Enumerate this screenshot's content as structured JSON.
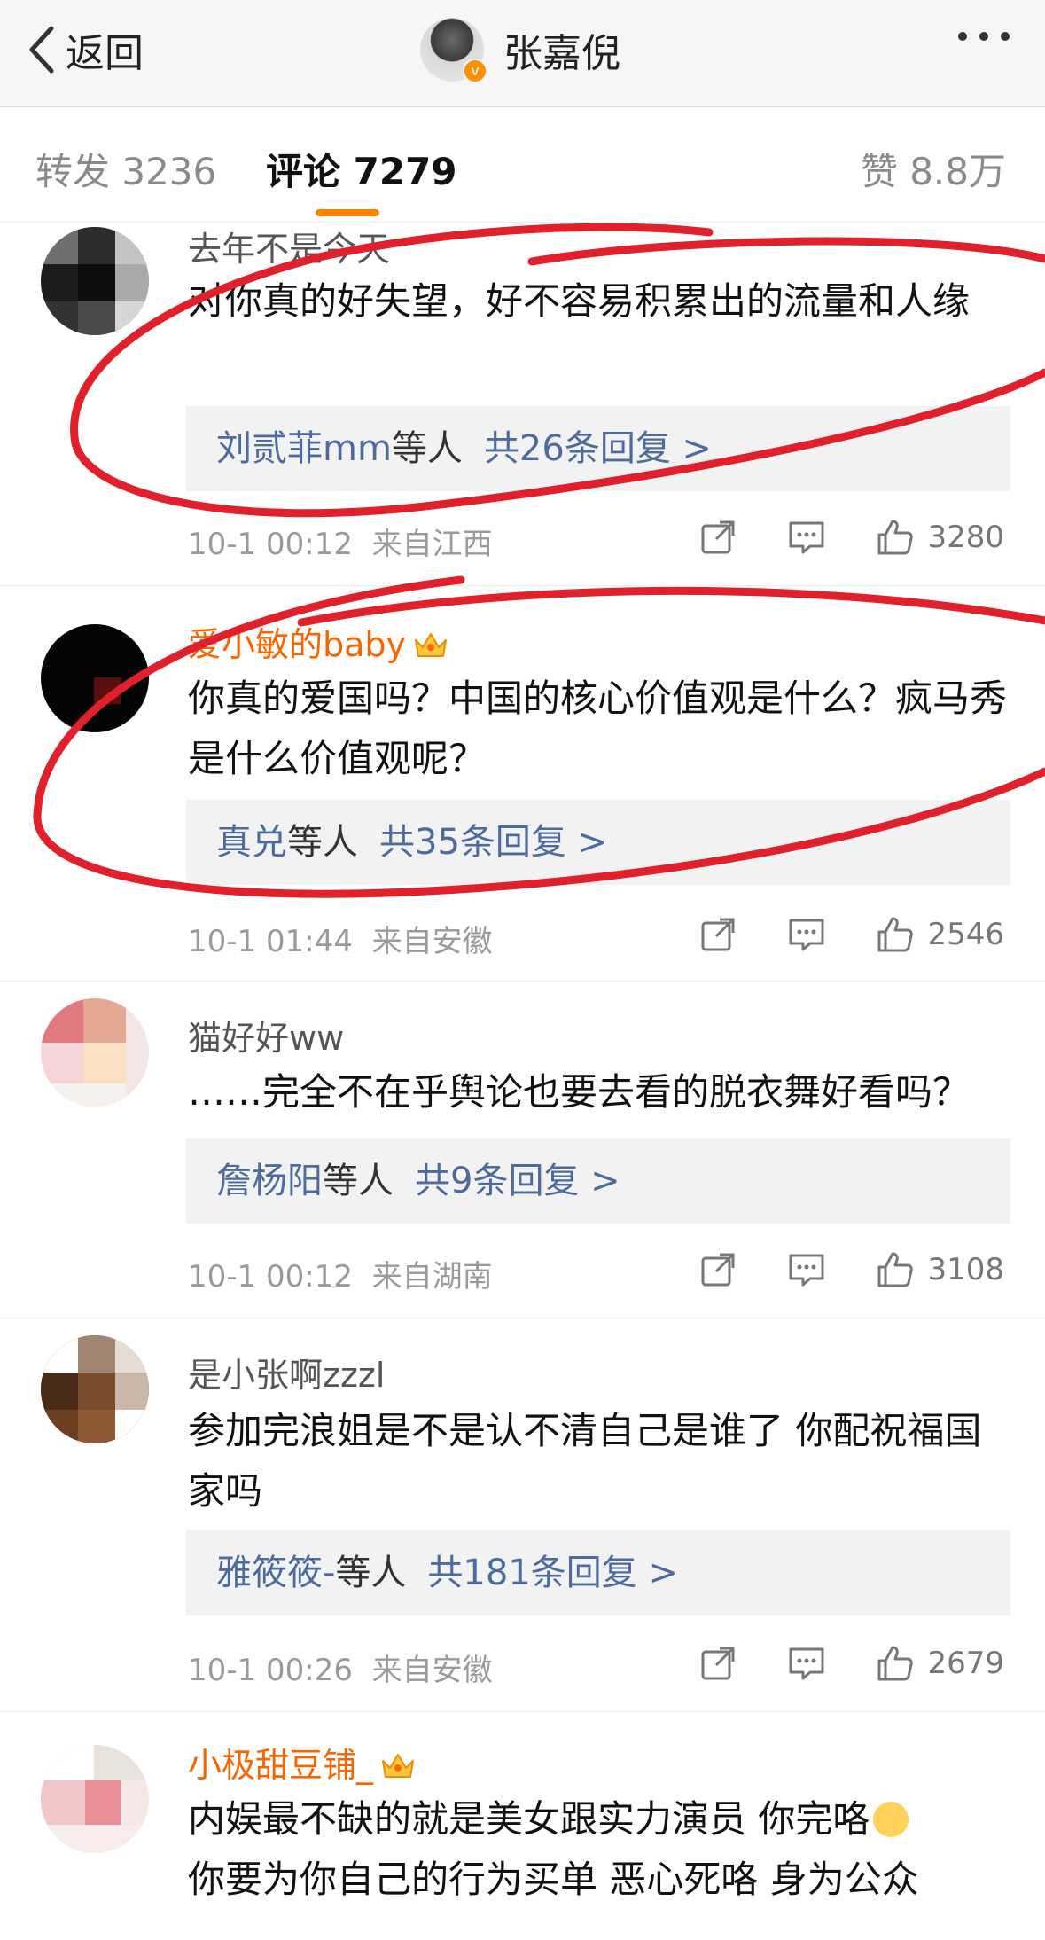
{
  "header": {
    "back_label": "返回",
    "profile_name": "张嘉倪",
    "verified_badge": "v"
  },
  "tabs": {
    "repost": "转发 3236",
    "comment": "评论 7279",
    "likes": "赞 8.8万"
  },
  "colors": {
    "accent": "#ff8200",
    "link": "#4d6b9f",
    "vip_name": "#f86400",
    "annotation": "#e0202a"
  },
  "comments": [
    {
      "user": "去年不是今天",
      "text": "对你真的好失望，好不容易积累出的流量和人缘",
      "replies_who": "刘贰菲mm",
      "replies_etc": "等人",
      "replies_count": "共26条回复 >",
      "time": "10-1 00:12",
      "location": "来自江西",
      "likes": "3280"
    },
    {
      "user": "爱小敏的baby",
      "text": "你真的爱国吗？中国的核心价值观是什么？疯马秀是什么价值观呢？",
      "replies_who": "真兑",
      "replies_etc": "等人",
      "replies_count": "共35条回复 >",
      "time": "10-1 01:44",
      "location": "来自安徽",
      "likes": "2546"
    },
    {
      "user": "猫好好ww",
      "text": "……完全不在乎舆论也要去看的脱衣舞好看吗？",
      "replies_who": "詹杨阳",
      "replies_etc": "等人",
      "replies_count": "共9条回复 >",
      "time": "10-1 00:12",
      "location": "来自湖南",
      "likes": "3108"
    },
    {
      "user": "是小张啊zzzl",
      "text": "参加完浪姐是不是认不清自己是谁了  你配祝福国家吗",
      "replies_who": "雅筱筱-",
      "replies_etc": "等人",
      "replies_count": "共181条回复 >",
      "time": "10-1 00:26",
      "location": "来自安徽",
      "likes": "2679"
    },
    {
      "user": "小极甜豆铺_",
      "text": "内娱最不缺的就是美女跟实力演员 你完咯",
      "text_line2": "你要为你自己的行为买单 恶心死咯 身为公众"
    }
  ],
  "icons": {
    "back": "chevron-left-icon",
    "more": "more-dots-icon",
    "share": "share-icon",
    "reply": "comment-icon",
    "like": "thumbs-up-icon",
    "vip": "crown-icon"
  }
}
